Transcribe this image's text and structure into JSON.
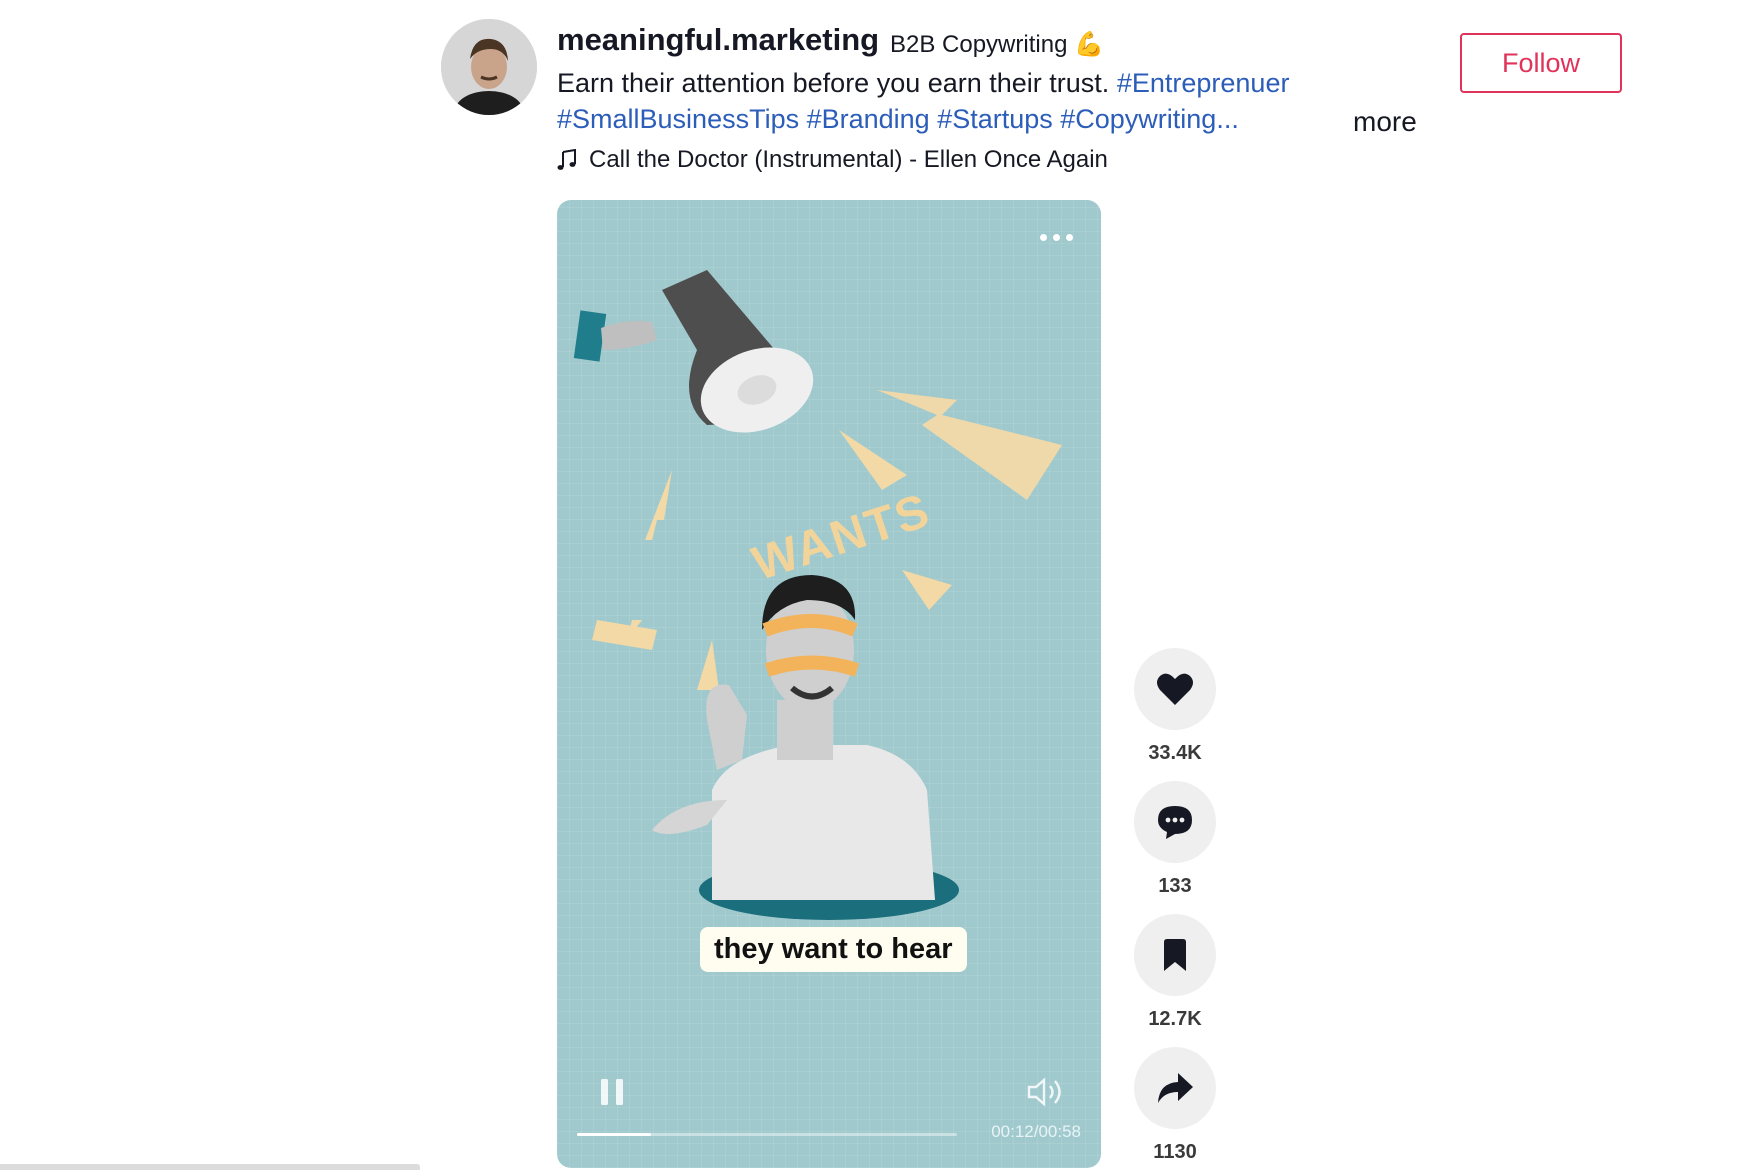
{
  "author": {
    "username": "meaningful.marketing",
    "nickname": "B2B Copywriting 💪",
    "avatar_icon": "profile-photo"
  },
  "description": {
    "line1_text": "Earn their attention before you earn their trust.",
    "line1_hashtag": "#Entreprenuer",
    "line2_hashtags": "#SmallBusinessTips #Branding #Startups #Copywriting...",
    "more_label": "more"
  },
  "music": {
    "icon": "music-note-icon",
    "title": "Call the Doctor (Instrumental) - Ellen Once Again"
  },
  "follow_label": "Follow",
  "video": {
    "overlay_word": "WANTS",
    "caption": "they want to hear",
    "time": "00:12/00:58",
    "progress": 0.195
  },
  "actions": [
    {
      "icon": "heart-icon",
      "count": "33.4K"
    },
    {
      "icon": "comment-icon",
      "count": "133"
    },
    {
      "icon": "bookmark-icon",
      "count": "12.7K"
    },
    {
      "icon": "share-icon",
      "count": "1130"
    }
  ],
  "colors": {
    "accent": "#e0335a",
    "hashtag": "#2b5db9",
    "video_bg": "#9fc9cd"
  }
}
